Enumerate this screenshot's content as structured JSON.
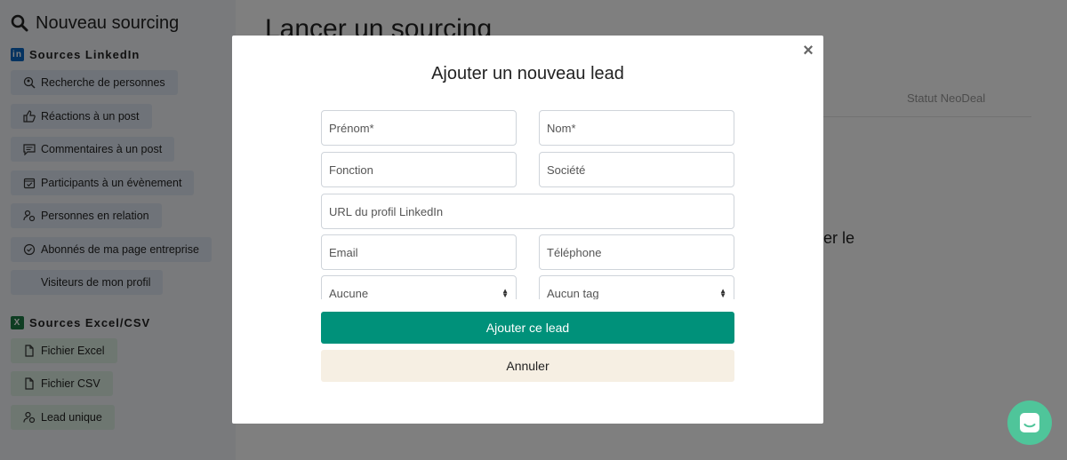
{
  "sidebar": {
    "title": "Nouveau sourcing",
    "linkedin_section": "Sources LinkedIn",
    "linkedin_items": [
      {
        "label": "Recherche de personnes",
        "icon": "person-search-icon"
      },
      {
        "label": "Réactions à un post",
        "icon": "thumbs-up-icon"
      },
      {
        "label": "Commentaires à un post",
        "icon": "comment-icon"
      },
      {
        "label": "Participants à un évènement",
        "icon": "calendar-check-icon"
      },
      {
        "label": "Personnes en relation",
        "icon": "people-connection-icon"
      },
      {
        "label": "Abonnés de ma page entreprise",
        "icon": "check-circle-icon"
      },
      {
        "label": "Visiteurs de mon profil",
        "icon": "eye-icon"
      }
    ],
    "excel_section": "Sources Excel/CSV",
    "excel_items": [
      {
        "label": "Fichier Excel",
        "icon": "file-icon"
      },
      {
        "label": "Fichier CSV",
        "icon": "file-icon"
      },
      {
        "label": "Lead unique",
        "icon": "person-icon"
      }
    ]
  },
  "main": {
    "title": "Lancer un sourcing",
    "column_header": "Statut NeoDeal",
    "fragment": "er le"
  },
  "modal": {
    "title": "Ajouter un nouveau lead",
    "fields": {
      "first_name": "Prénom*",
      "last_name": "Nom*",
      "function": "Fonction",
      "company": "Société",
      "linkedin_url": "URL du profil LinkedIn",
      "email": "Email",
      "phone": "Téléphone"
    },
    "select_list": "Aucune",
    "select_tag": "Aucun tag",
    "add_button": "Ajouter ce lead",
    "cancel_button": "Annuler",
    "close_symbol": "×"
  },
  "colors": {
    "primary": "#00917a",
    "cancel_bg": "#f6efe3",
    "chat_bubble": "#4fc59a",
    "linkedin": "#0a66c2",
    "excel": "#1d7a44"
  }
}
